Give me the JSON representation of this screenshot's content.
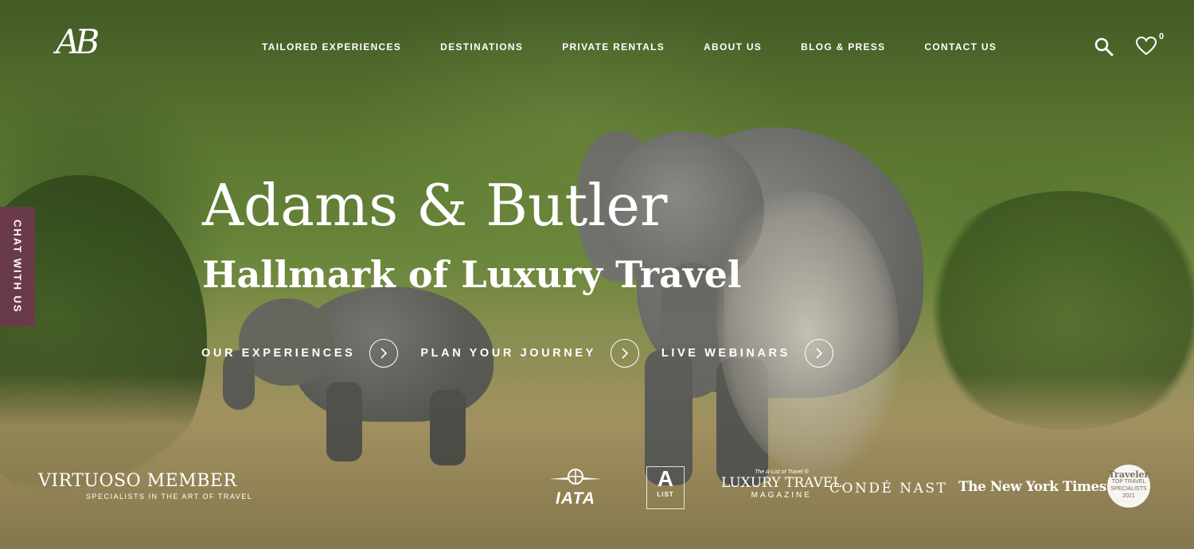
{
  "brand": {
    "logo_text": "AB"
  },
  "nav": {
    "items": [
      {
        "label": "TAILORED EXPERIENCES"
      },
      {
        "label": "DESTINATIONS"
      },
      {
        "label": "PRIVATE RENTALS"
      },
      {
        "label": "ABOUT US"
      },
      {
        "label": "BLOG & PRESS"
      },
      {
        "label": "CONTACT US"
      }
    ]
  },
  "header_actions": {
    "search_icon": "search-icon",
    "wishlist_icon": "heart-icon",
    "wishlist_count": "0"
  },
  "chat": {
    "label": "CHAT WITH US",
    "color": "#6b3a4a"
  },
  "hero": {
    "title": "Adams & Butler",
    "subtitle": "Hallmark of Luxury Travel",
    "ctas": [
      {
        "label": "OUR EXPERIENCES",
        "icon": "chevron-right-icon"
      },
      {
        "label": "PLAN YOUR JOURNEY",
        "icon": "chevron-right-icon"
      },
      {
        "label": "LIVE WEBINARS",
        "icon": "chevron-right-icon"
      }
    ]
  },
  "partners": {
    "virtuoso": {
      "main": "VIRTUOSO MEMBER",
      "sub": "SPECIALISTS IN THE ART OF TRAVEL"
    },
    "iata": {
      "word": "IATA"
    },
    "alist": {
      "big": "A",
      "small": "LIST"
    },
    "luxury": {
      "tiny": "The A-List of Travel ®",
      "main": "LUXURY TRAVEL",
      "mag": "MAGAZINE"
    },
    "conde": "CONDÉ NAST",
    "nyt": "The New York Times",
    "traveler": {
      "name": "Traveler",
      "line1": "TOP TRAVEL",
      "line2": "SPECIALISTS",
      "year": "2021"
    }
  }
}
